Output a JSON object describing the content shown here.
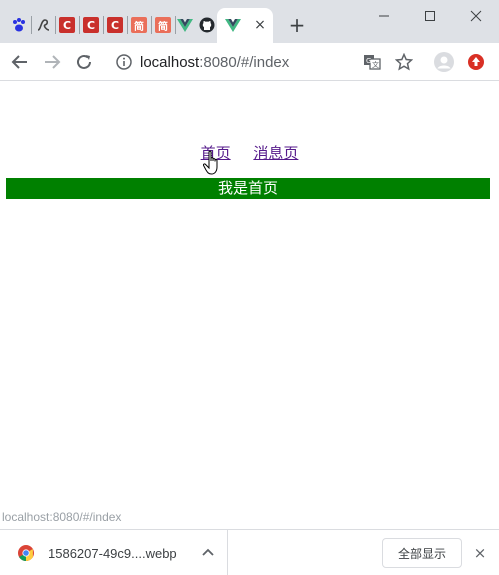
{
  "browser": {
    "tabs": [
      {
        "icon": "baidu-paw-icon",
        "color": "#2932e1"
      },
      {
        "icon": "script-icon",
        "color": "#444444"
      },
      {
        "icon": "csdn-c-icon",
        "color": "#c9302c",
        "glyph": "C"
      },
      {
        "icon": "csdn-c-icon",
        "color": "#c9302c",
        "glyph": "C"
      },
      {
        "icon": "csdn-c-icon",
        "color": "#c9302c",
        "glyph": "C"
      },
      {
        "icon": "jianshu-icon",
        "color": "#ea6f5a",
        "glyph": "简"
      },
      {
        "icon": "jianshu-icon",
        "color": "#ea6f5a",
        "glyph": "简"
      },
      {
        "icon": "vue-icon",
        "color": "#41b883"
      },
      {
        "icon": "github-icon",
        "color": "#24292e"
      },
      {
        "icon": "vue-icon",
        "color": "#41b883"
      }
    ],
    "active_tab": {
      "icon": "vue-icon",
      "close": "×"
    },
    "new_tab": "+",
    "address": {
      "host": "localhost",
      "rest": ":8080/#/index"
    }
  },
  "page": {
    "nav": [
      {
        "label": "首页"
      },
      {
        "label": "消息页"
      }
    ],
    "banner": "我是首页",
    "banner_color": "#008000",
    "link_color": "#551a8b",
    "status_url": "localhost:8080/#/index"
  },
  "downloads": {
    "file_name": "1586207-49c9....webp",
    "show_all": "全部显示",
    "close": "×"
  }
}
